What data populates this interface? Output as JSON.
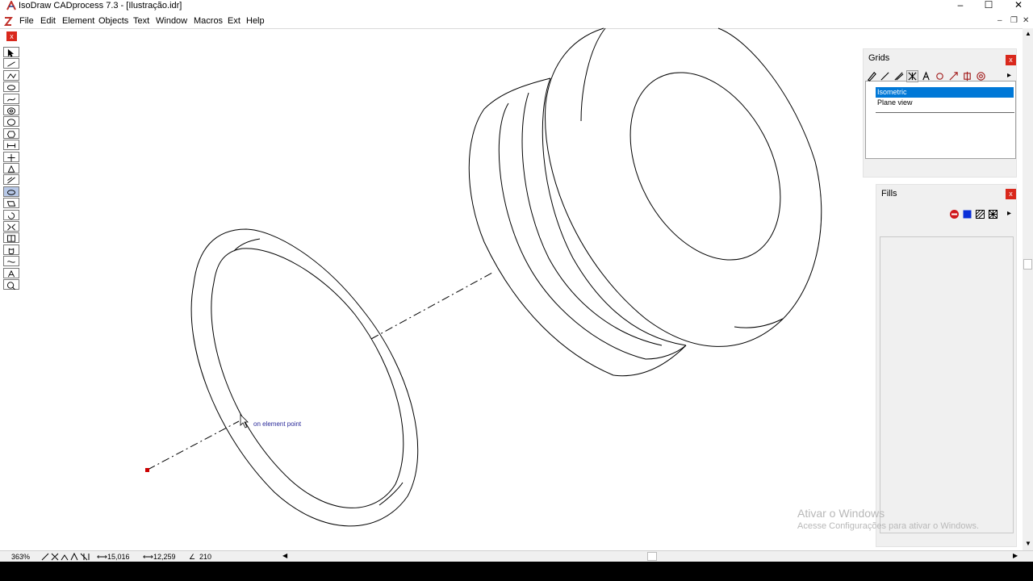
{
  "window": {
    "title": "IsoDraw CADprocess 7.3 - [Ilustração.idr]",
    "minimize": "–",
    "maximize": "☐",
    "close": "✕"
  },
  "menubar": {
    "items": [
      "File",
      "Edit",
      "Element",
      "Objects",
      "Text",
      "Window",
      "Macros",
      "Ext",
      "Help"
    ],
    "mdi_minimize": "–",
    "mdi_restore": "❐",
    "mdi_close": "✕"
  },
  "toolbox": {
    "close_label": "x",
    "tools": [
      "pointer-tool",
      "line-tool",
      "polyline-tool",
      "ellipse-tool",
      "bezier-tool",
      "iso-ellipse-tool",
      "iso-ellipse-2-tool",
      "polygon-tool",
      "dimension-tool",
      "align-tool",
      "fill-tool",
      "hatch-tool",
      "iso-circle-tool",
      "iso-rect-tool",
      "rotate-tool",
      "mirror-tool",
      "group-tool",
      "cylinder-tool",
      "break-tool",
      "text-tool",
      "zoom-tool"
    ],
    "selected": "iso-circle-tool"
  },
  "canvas": {
    "snap_hint": "on element point"
  },
  "grids_panel": {
    "title": "Grids",
    "close_label": "x",
    "tools": [
      "pen-icon",
      "dashed-line-icon",
      "line-icon",
      "grid-pattern-icon",
      "text-a-icon",
      "zoom-grid-icon",
      "arrow-icon",
      "transform-icon",
      "settings-icon"
    ],
    "more_label": "▸",
    "items": [
      "Isometric",
      "Plane view"
    ],
    "selected": "Isometric"
  },
  "fills_panel": {
    "title": "Fills",
    "close_label": "x",
    "tools": [
      "no-fill-icon",
      "solid-fill-icon",
      "hatch-fill-icon",
      "pattern-fill-icon"
    ],
    "more_label": "▸"
  },
  "statusbar": {
    "zoom": "363%",
    "x_value": "15,016",
    "y_value": "12,259",
    "angle_value": "210"
  },
  "watermark": {
    "line1": "Ativar o Windows",
    "line2": "Acesse Configurações para ativar o Windows."
  },
  "colors": {
    "accent": "#0078d7",
    "close_red": "#d9281c",
    "snap_text": "#2a2a9a",
    "point_red": "#cc0000"
  }
}
